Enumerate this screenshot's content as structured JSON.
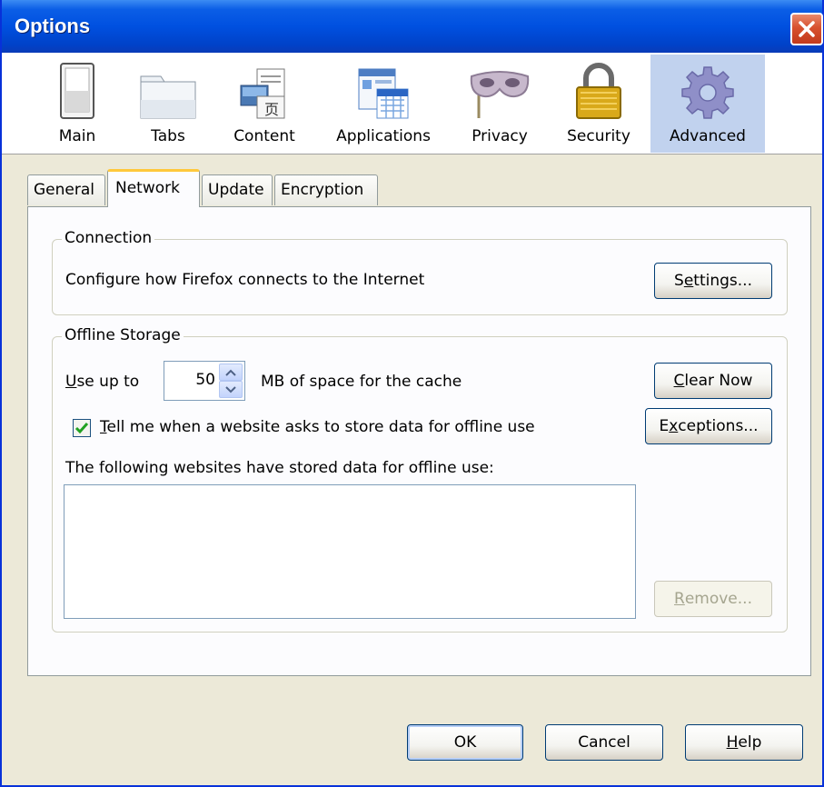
{
  "window": {
    "title": "Options"
  },
  "panes": [
    {
      "label": "Main",
      "icon": "main-icon"
    },
    {
      "label": "Tabs",
      "icon": "tabs-icon"
    },
    {
      "label": "Content",
      "icon": "content-icon"
    },
    {
      "label": "Applications",
      "icon": "applications-icon"
    },
    {
      "label": "Privacy",
      "icon": "privacy-mask-icon"
    },
    {
      "label": "Security",
      "icon": "padlock-icon"
    },
    {
      "label": "Advanced",
      "icon": "gear-icon",
      "selected": true
    }
  ],
  "tabs": [
    {
      "label": "General"
    },
    {
      "label": "Network",
      "selected": true
    },
    {
      "label": "Update"
    },
    {
      "label": "Encryption"
    }
  ],
  "connection": {
    "group_title": "Connection",
    "description": "Configure how Firefox connects to the Internet",
    "settings_button": {
      "pre": "S",
      "accel": "e",
      "post": "ttings..."
    }
  },
  "offline": {
    "group_title": "Offline Storage",
    "use_up_to": {
      "accel": "U",
      "post": "se up to"
    },
    "cache_value": "50",
    "cache_suffix": "MB of space for the cache",
    "clear_now": {
      "accel": "C",
      "post": "lear Now"
    },
    "tell_me": {
      "accel": "T",
      "post": "ell me when a website asks to store data for offline use"
    },
    "tell_me_checked": true,
    "exceptions": {
      "pre": "E",
      "accel": "x",
      "post": "ceptions..."
    },
    "stored_label": "The following websites have stored data for offline use:",
    "stored_sites": [],
    "remove": {
      "accel": "R",
      "post": "emove..."
    }
  },
  "footer": {
    "ok": "OK",
    "cancel": "Cancel",
    "help": {
      "accel": "H",
      "post": "elp"
    }
  },
  "colors": {
    "titlebar": "#0050e0",
    "selected_pane": "#c1d2ee",
    "selected_tab_accent": "#ffc83c",
    "close_button": "#d8512f",
    "window_bg": "#ece9d8"
  }
}
